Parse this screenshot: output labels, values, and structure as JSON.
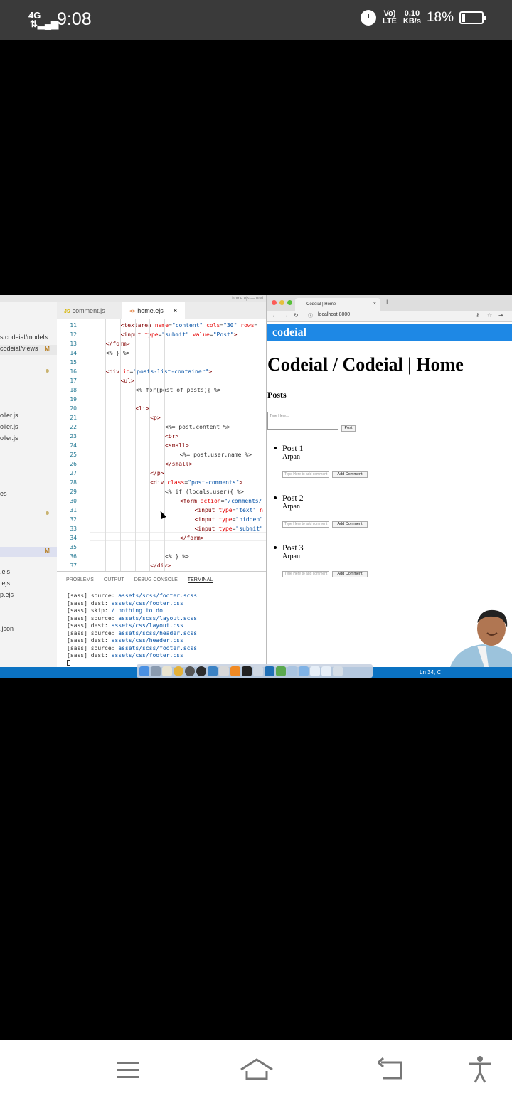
{
  "status_bar": {
    "network": "4G",
    "time": "9:08",
    "volte": "Vo) LTE",
    "speed_value": "0.10",
    "speed_unit": "KB/s",
    "battery_pct": "18%",
    "battery_level": 0.18
  },
  "ide": {
    "window_title": "home.ejs — nod",
    "sidebar": [
      {
        "label": "s codeial/models",
        "m": ""
      },
      {
        "label": "codeial/views",
        "m": "M"
      },
      {
        "label": "oller.js",
        "m": ""
      },
      {
        "label": "oller.js",
        "m": ""
      },
      {
        "label": "oller.js",
        "m": ""
      },
      {
        "label": "es",
        "m": ""
      },
      {
        "label": "",
        "m": "M"
      },
      {
        "label": ".ejs",
        "m": ""
      },
      {
        "label": ".ejs",
        "m": ""
      },
      {
        "label": "p.ejs",
        "m": ""
      },
      {
        "label": ".json",
        "m": ""
      }
    ],
    "tabs": [
      {
        "icon": "JS",
        "label": "comment.js"
      },
      {
        "icon": "<>",
        "label": "home.ejs",
        "close": "×"
      }
    ],
    "code_lines": [
      {
        "n": "11",
        "indent": 2,
        "html": "<span class='tg'>&lt;textarea</span> <span class='at'>name</span>=<span class='st'>\"content\"</span> <span class='at'>cols</span>=<span class='st'>\"30\"</span> <span class='at'>rows</span>="
      },
      {
        "n": "12",
        "indent": 2,
        "html": "<span class='tg'>&lt;input</span> <span class='at'>type</span>=<span class='st'>\"submit\"</span> <span class='at'>value</span>=<span class='st'>\"Post\"</span><span class='tg'>&gt;</span>"
      },
      {
        "n": "13",
        "indent": 1,
        "html": "<span class='tg'>&lt;/form&gt;</span>"
      },
      {
        "n": "14",
        "indent": 1,
        "html": "&lt;% } %&gt;"
      },
      {
        "n": "15",
        "indent": 0,
        "html": ""
      },
      {
        "n": "16",
        "indent": 1,
        "html": "<span class='tg'>&lt;div</span> <span class='at'>id</span>=<span class='st'>\"posts-list-container\"</span><span class='tg'>&gt;</span>"
      },
      {
        "n": "17",
        "indent": 2,
        "html": "<span class='tg'>&lt;ul&gt;</span>"
      },
      {
        "n": "18",
        "indent": 3,
        "html": "&lt;% for(post of posts){ %&gt;"
      },
      {
        "n": "19",
        "indent": 0,
        "html": ""
      },
      {
        "n": "20",
        "indent": 3,
        "html": "<span class='tg'>&lt;li&gt;</span>"
      },
      {
        "n": "21",
        "indent": 4,
        "html": "<span class='tg'>&lt;p&gt;</span>"
      },
      {
        "n": "22",
        "indent": 5,
        "html": "&lt;%= post.content %&gt;"
      },
      {
        "n": "23",
        "indent": 5,
        "html": "<span class='tg'>&lt;br&gt;</span>"
      },
      {
        "n": "24",
        "indent": 5,
        "html": "<span class='tg'>&lt;small&gt;</span>"
      },
      {
        "n": "25",
        "indent": 6,
        "html": "&lt;%= post.user.name %&gt;"
      },
      {
        "n": "26",
        "indent": 5,
        "html": "<span class='tg'>&lt;/small&gt;</span>"
      },
      {
        "n": "27",
        "indent": 4,
        "html": "<span class='tg'>&lt;/p&gt;</span>"
      },
      {
        "n": "28",
        "indent": 4,
        "html": "<span class='tg'>&lt;div</span> <span class='at'>class</span>=<span class='st'>\"post-comments\"</span><span class='tg'>&gt;</span>"
      },
      {
        "n": "29",
        "indent": 5,
        "html": "&lt;% if (locals.user){ %&gt;"
      },
      {
        "n": "30",
        "indent": 6,
        "html": "<span class='tg'>&lt;form</span> <span class='at'>action</span>=<span class='st'>\"/comments/</span>"
      },
      {
        "n": "31",
        "indent": 7,
        "html": "<span class='tg'>&lt;input</span> <span class='at'>type</span>=<span class='st'>\"text\"</span> <span class='at'>n</span>"
      },
      {
        "n": "32",
        "indent": 7,
        "html": "<span class='tg'>&lt;input</span> <span class='at'>type</span>=<span class='st'>\"hidden\"</span>"
      },
      {
        "n": "33",
        "indent": 7,
        "html": "<span class='tg'>&lt;input</span> <span class='at'>type</span>=<span class='st'>\"submit\"</span>"
      },
      {
        "n": "34",
        "indent": 6,
        "html": "<span class='tg'>&lt;/form&gt;</span>"
      },
      {
        "n": "35",
        "indent": 0,
        "html": ""
      },
      {
        "n": "36",
        "indent": 5,
        "html": "&lt;% } %&gt;"
      },
      {
        "n": "37",
        "indent": 4,
        "html": "<span class='tg'>&lt;/div&gt;</span>"
      }
    ],
    "panel_tabs": [
      "PROBLEMS",
      "OUTPUT",
      "DEBUG CONSOLE",
      "TERMINAL"
    ],
    "active_panel_tab": "TERMINAL",
    "terminal_lines": [
      {
        "prefix": "[sass]",
        "key": "source:",
        "val": "assets/scss/footer.scss"
      },
      {
        "prefix": "[sass]",
        "key": "dest:",
        "val": "assets/css/footer.css"
      },
      {
        "prefix": "[sass]",
        "key": "skip:",
        "val": "/ nothing to do"
      },
      {
        "prefix": "[sass]",
        "key": "source:",
        "val": "assets/scss/layout.scss"
      },
      {
        "prefix": "[sass]",
        "key": "dest:",
        "val": "assets/css/layout.css"
      },
      {
        "prefix": "[sass]",
        "key": "source:",
        "val": "assets/scss/header.scss"
      },
      {
        "prefix": "[sass]",
        "key": "dest:",
        "val": "assets/css/header.css"
      },
      {
        "prefix": "[sass]",
        "key": "source:",
        "val": "assets/scss/footer.scss"
      },
      {
        "prefix": "[sass]",
        "key": "dest:",
        "val": "assets/css/footer.css"
      }
    ],
    "status_position": "Ln 34, C"
  },
  "browser": {
    "tab_title": "Codeial | Home",
    "tab_close": "×",
    "new_tab": "+",
    "url": "localhost:8000",
    "page": {
      "brand": "codeial",
      "heading": "Codeial / Codeial | Home",
      "section": "Posts",
      "textarea_placeholder": "Type Here...",
      "post_button": "Post",
      "comment_placeholder": "Type Here to add comment",
      "comment_button": "Add Comment",
      "posts": [
        {
          "content": "Post 1",
          "author": "Arpan"
        },
        {
          "content": "Post 2",
          "author": "Arpan"
        },
        {
          "content": "Post 3",
          "author": "Arpan"
        }
      ]
    }
  },
  "colors": {
    "accent": "#1e88e5",
    "ide_status": "#0b72c2",
    "status_bar": "#3a3a3a"
  }
}
